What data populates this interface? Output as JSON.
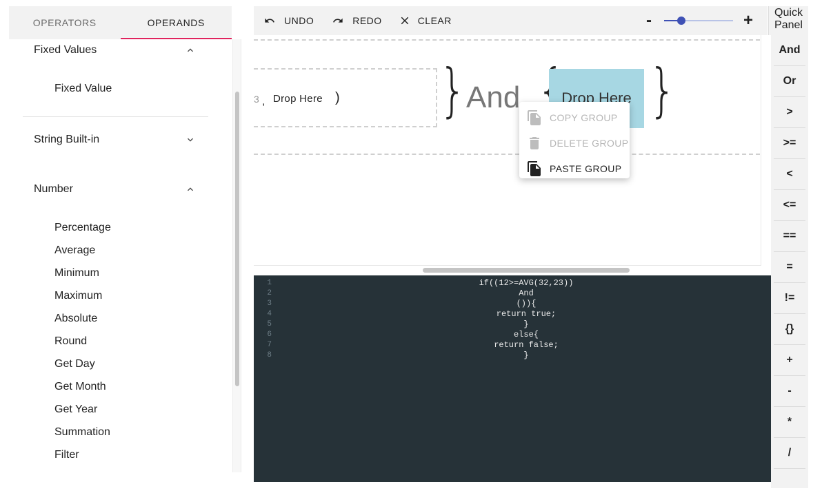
{
  "tabs": [
    {
      "label": "OPERATORS",
      "active": false
    },
    {
      "label": "OPERANDS",
      "active": true
    }
  ],
  "tree": {
    "fixed_values": {
      "label": "Fixed Values",
      "expanded": true,
      "items": [
        "Fixed Value"
      ]
    },
    "string_builtin": {
      "label": "String Built-in",
      "expanded": false
    },
    "number": {
      "label": "Number",
      "expanded": true,
      "items": [
        "Percentage",
        "Average",
        "Minimum",
        "Maximum",
        "Absolute",
        "Round",
        "Get Day",
        "Get Month",
        "Get Year",
        "Summation",
        "Filter"
      ]
    }
  },
  "toolbar": {
    "undo_label": "UNDO",
    "redo_label": "REDO",
    "clear_label": "CLEAR",
    "zoom_minus": "-",
    "zoom_plus": "+",
    "zoom_level": 0.25
  },
  "quick_panel": {
    "title": "Quick Panel",
    "items": [
      "And",
      "Or",
      ">",
      ">=",
      "<",
      "<=",
      "==",
      "=",
      "!=",
      "{}",
      "+",
      "-",
      "*",
      "/"
    ]
  },
  "canvas": {
    "fragment_3": "3",
    "comma": ",",
    "drop_left": "Drop Here",
    "close_paren": ")",
    "brace_left": "}",
    "and_label": "And",
    "brace_open": "{",
    "drop_box": "Drop Here",
    "brace_close": "}"
  },
  "context_menu": {
    "copy_group": "COPY GROUP",
    "delete_group": "DELETE GROUP",
    "paste_group": "PASTE GROUP"
  },
  "code": {
    "lines": [
      {
        "n": "1",
        "text": "if((12>=AVG(32,23))"
      },
      {
        "n": "2",
        "text": "And"
      },
      {
        "n": "3",
        "text": "()){"
      },
      {
        "n": "4",
        "text": "return true;"
      },
      {
        "n": "5",
        "text": "}"
      },
      {
        "n": "6",
        "text": "else{"
      },
      {
        "n": "7",
        "text": "return false;"
      },
      {
        "n": "8",
        "text": "}"
      }
    ]
  },
  "colors": {
    "accent_tab": "#e0245e",
    "slider": "#3f51b5",
    "drop_box": "#a7d7e3",
    "code_bg": "#263238"
  }
}
